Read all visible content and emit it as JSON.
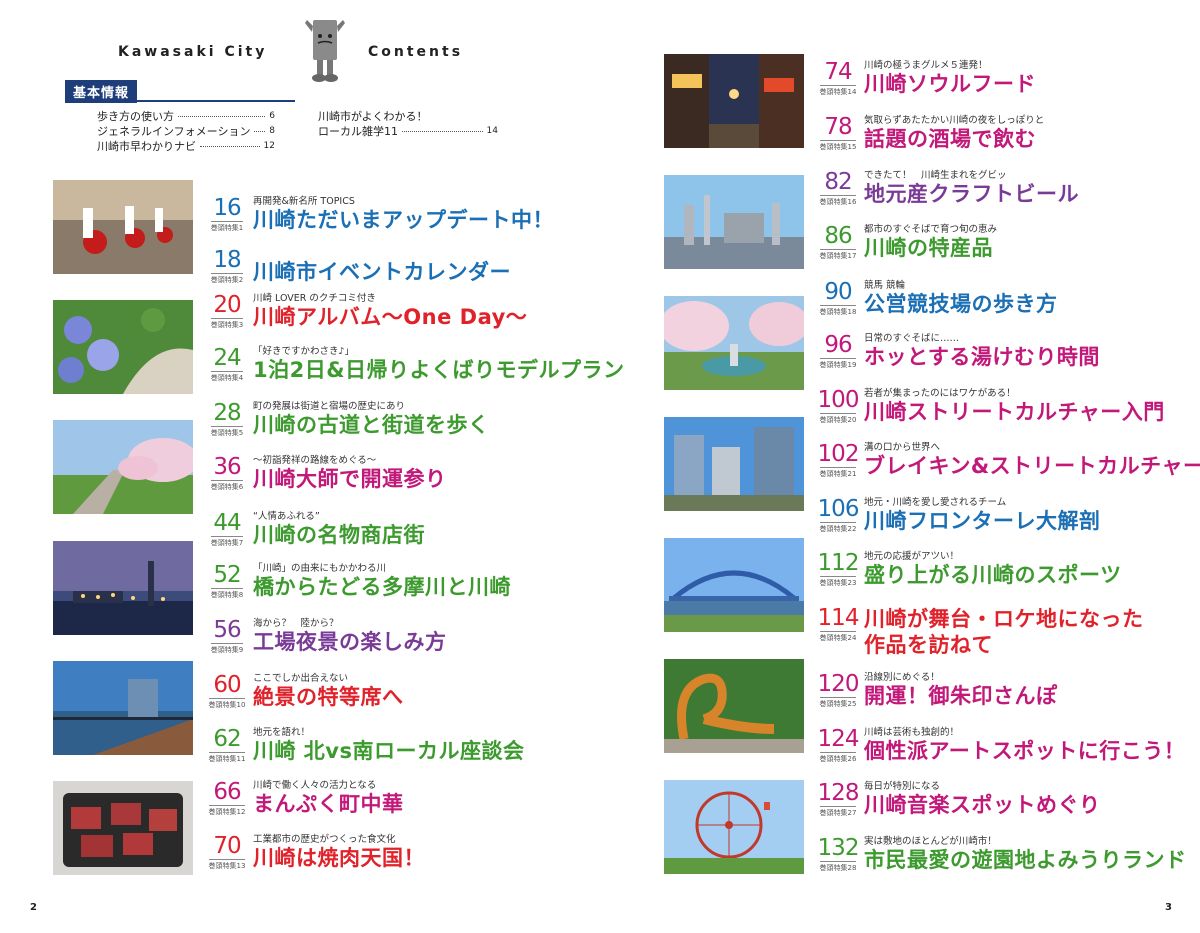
{
  "header": {
    "left": "Kawasaki City",
    "right": "Contents"
  },
  "basic": {
    "badge": "基本情報",
    "items": [
      {
        "label": "歩き方の使い方",
        "page": "6"
      },
      {
        "label": "ジェネラルインフォメーション",
        "page": "8"
      },
      {
        "label": "川崎市早わかりナビ",
        "page": "12"
      },
      {
        "label": "川崎市がよくわかる！",
        "page": ""
      },
      {
        "label": "ローカル雑学11",
        "page": "14"
      }
    ]
  },
  "colors": {
    "blue": "#1b6fb4",
    "red": "#e0222b",
    "magenta": "#c2187a",
    "green": "#3d9a2e",
    "purple": "#7a3b97",
    "navy": "#1d3e7a"
  },
  "entries": [
    {
      "num": "16",
      "tag": "巻頭特集1",
      "sub": "再開発&新名所 TOPICS",
      "main": "川崎ただいまアップデート中！",
      "color": "#1b6fb4"
    },
    {
      "num": "18",
      "tag": "巻頭特集2",
      "sub": "",
      "main": "川崎市イベントカレンダー",
      "color": "#1b6fb4"
    },
    {
      "num": "20",
      "tag": "巻頭特集3",
      "sub": "川崎 LOVER のクチコミ付き",
      "main": "川崎アルバム～One Day～",
      "color": "#e0222b"
    },
    {
      "num": "24",
      "tag": "巻頭特集4",
      "sub": "「好きですかわさき♪」",
      "main": "1泊2日&日帰りよくばりモデルプラン",
      "color": "#3d9a2e"
    },
    {
      "num": "28",
      "tag": "巻頭特集5",
      "sub": "町の発展は街道と宿場の歴史にあり",
      "main": "川崎の古道と街道を歩く",
      "color": "#3d9a2e"
    },
    {
      "num": "36",
      "tag": "巻頭特集6",
      "sub": "～初詣発祥の路線をめぐる～",
      "main": "川崎大師で開運参り",
      "color": "#c2187a"
    },
    {
      "num": "44",
      "tag": "巻頭特集7",
      "sub": "“人情あふれる”",
      "main": "川崎の名物商店街",
      "color": "#3d9a2e"
    },
    {
      "num": "52",
      "tag": "巻頭特集8",
      "sub": "「川崎」の由来にもかかわる川",
      "main": "橋からたどる多摩川と川崎",
      "color": "#3d9a2e"
    },
    {
      "num": "56",
      "tag": "巻頭特集9",
      "sub": "海から？　陸から？",
      "main": "工場夜景の楽しみ方",
      "color": "#7a3b97"
    },
    {
      "num": "60",
      "tag": "巻頭特集10",
      "sub": "ここでしか出合えない",
      "main": "絶景の特等席へ",
      "color": "#e0222b"
    },
    {
      "num": "62",
      "tag": "巻頭特集11",
      "sub": "地元を語れ！",
      "main": "川崎 北vs南ローカル座談会",
      "color": "#3d9a2e"
    },
    {
      "num": "66",
      "tag": "巻頭特集12",
      "sub": "川崎で働く人々の活力となる",
      "main": "まんぷく町中華",
      "color": "#c2187a"
    },
    {
      "num": "70",
      "tag": "巻頭特集13",
      "sub": "工業都市の歴史がつくった食文化",
      "main": "川崎は焼肉天国！",
      "color": "#e0222b"
    },
    {
      "num": "74",
      "tag": "巻頭特集14",
      "sub": "川崎の極うまグルメ５連発！",
      "main": "川崎ソウルフード",
      "color": "#c2187a"
    },
    {
      "num": "78",
      "tag": "巻頭特集15",
      "sub": "気取らずあたたかい川崎の夜をしっぽりと",
      "main": "話題の酒場で飲む",
      "color": "#c2187a"
    },
    {
      "num": "82",
      "tag": "巻頭特集16",
      "sub": "できたて！　川崎生まれをグビッ",
      "main": "地元産クラフトビール",
      "color": "#7a3b97"
    },
    {
      "num": "86",
      "tag": "巻頭特集17",
      "sub": "都市のすぐそばで育つ旬の恵み",
      "main": "川崎の特産品",
      "color": "#3d9a2e"
    },
    {
      "num": "90",
      "tag": "巻頭特集18",
      "sub": "競馬 競輪",
      "main": "公営競技場の歩き方",
      "color": "#1b6fb4"
    },
    {
      "num": "96",
      "tag": "巻頭特集19",
      "sub": "日常のすぐそばに……",
      "main": "ホッとする湯けむり時間",
      "color": "#c2187a"
    },
    {
      "num": "100",
      "tag": "巻頭特集20",
      "sub": "若者が集まったのにはワケがある！",
      "main": "川崎ストリートカルチャー入門",
      "color": "#c2187a"
    },
    {
      "num": "102",
      "tag": "巻頭特集21",
      "sub": "溝の口から世界へ",
      "main": "ブレイキン&ストリートカルチャー",
      "color": "#c2187a"
    },
    {
      "num": "106",
      "tag": "巻頭特集22",
      "sub": "地元・川崎を愛し愛されるチーム",
      "main": "川崎フロンターレ大解剖",
      "color": "#1b6fb4"
    },
    {
      "num": "112",
      "tag": "巻頭特集23",
      "sub": "地元の応援がアツい！",
      "main": "盛り上がる川崎のスポーツ",
      "color": "#3d9a2e"
    },
    {
      "num": "114",
      "tag": "巻頭特集24",
      "sub": "",
      "main": "川崎が舞台・ロケ地になった",
      "main2": "作品を訪ねて",
      "color": "#e0222b"
    },
    {
      "num": "120",
      "tag": "巻頭特集25",
      "sub": "沿線別にめぐる！",
      "main": "開運！御朱印さんぽ",
      "color": "#c2187a"
    },
    {
      "num": "124",
      "tag": "巻頭特集26",
      "sub": "川崎は芸術も独創的！",
      "main": "個性派アートスポットに行こう！",
      "color": "#c2187a"
    },
    {
      "num": "128",
      "tag": "巻頭特集27",
      "sub": "毎日が特別になる",
      "main": "川崎音楽スポットめぐり",
      "color": "#c2187a"
    },
    {
      "num": "132",
      "tag": "巻頭特集28",
      "sub": "実は敷地のほとんどが川崎市！",
      "main": "市民最愛の遊園地よみうりランド",
      "color": "#3d9a2e"
    }
  ],
  "photos": [
    "festival-parade",
    "hydrangea-garden",
    "riverside-cherry-path",
    "factory-night-view",
    "waterfront-promenade",
    "grilled-beef",
    "izakaya-alley",
    "industrial-plant",
    "cherry-fountain-park",
    "station-towers",
    "arch-bridge",
    "dinosaur-slide",
    "ferris-wheel"
  ],
  "page_numbers": {
    "left": "2",
    "right": "3"
  }
}
